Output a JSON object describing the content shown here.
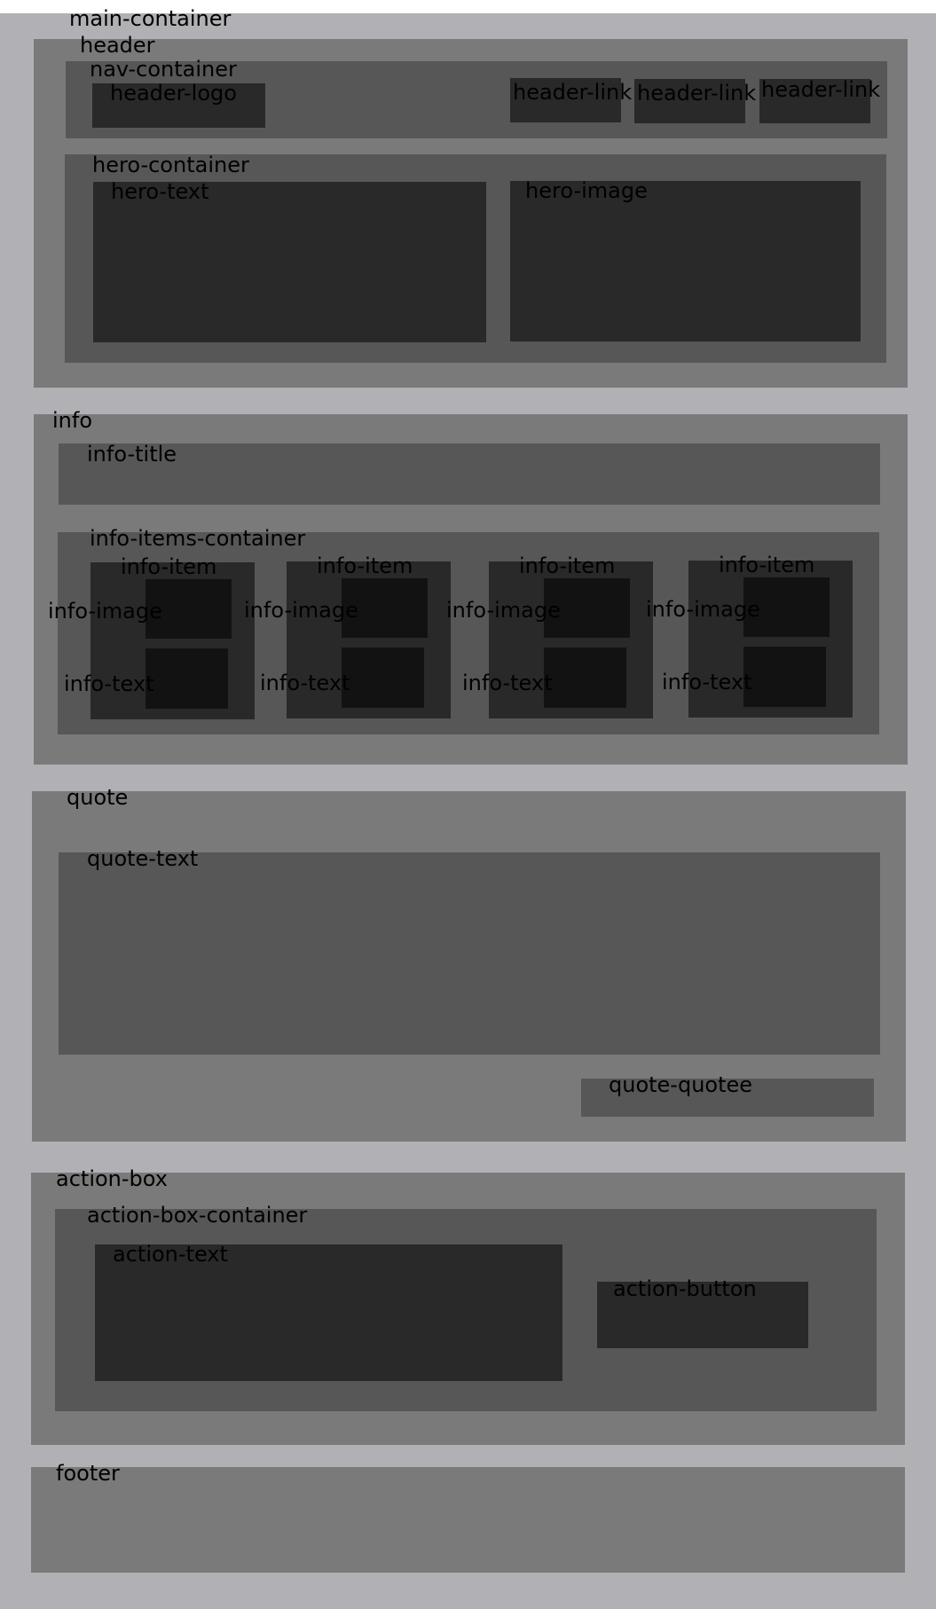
{
  "colors": {
    "page_background": "#b1b1b5",
    "level1": "#7a7a7a",
    "level2": "#575757",
    "level3": "#292929",
    "level4": "#121212",
    "label_text": "#000000"
  },
  "main_container": {
    "label": "main-container"
  },
  "header": {
    "label": "header",
    "nav_container": {
      "label": "nav-container",
      "logo": "header-logo",
      "links": [
        "header-link",
        "header-link",
        "header-link"
      ]
    },
    "hero_container": {
      "label": "hero-container",
      "text": "hero-text",
      "image": "hero-image"
    }
  },
  "info": {
    "label": "info",
    "title": "info-title",
    "items_container": {
      "label": "info-items-container",
      "items": [
        {
          "label": "info-item",
          "image": "info-image",
          "text": "info-text"
        },
        {
          "label": "info-item",
          "image": "info-image",
          "text": "info-text"
        },
        {
          "label": "info-item",
          "image": "info-image",
          "text": "info-text"
        },
        {
          "label": "info-item",
          "image": "info-image",
          "text": "info-text"
        }
      ]
    }
  },
  "quote": {
    "label": "quote",
    "text": "quote-text",
    "quotee": "quote-quotee"
  },
  "action_box": {
    "label": "action-box",
    "container": {
      "label": "action-box-container",
      "text": "action-text",
      "button": "action-button"
    }
  },
  "footer": {
    "label": "footer"
  }
}
